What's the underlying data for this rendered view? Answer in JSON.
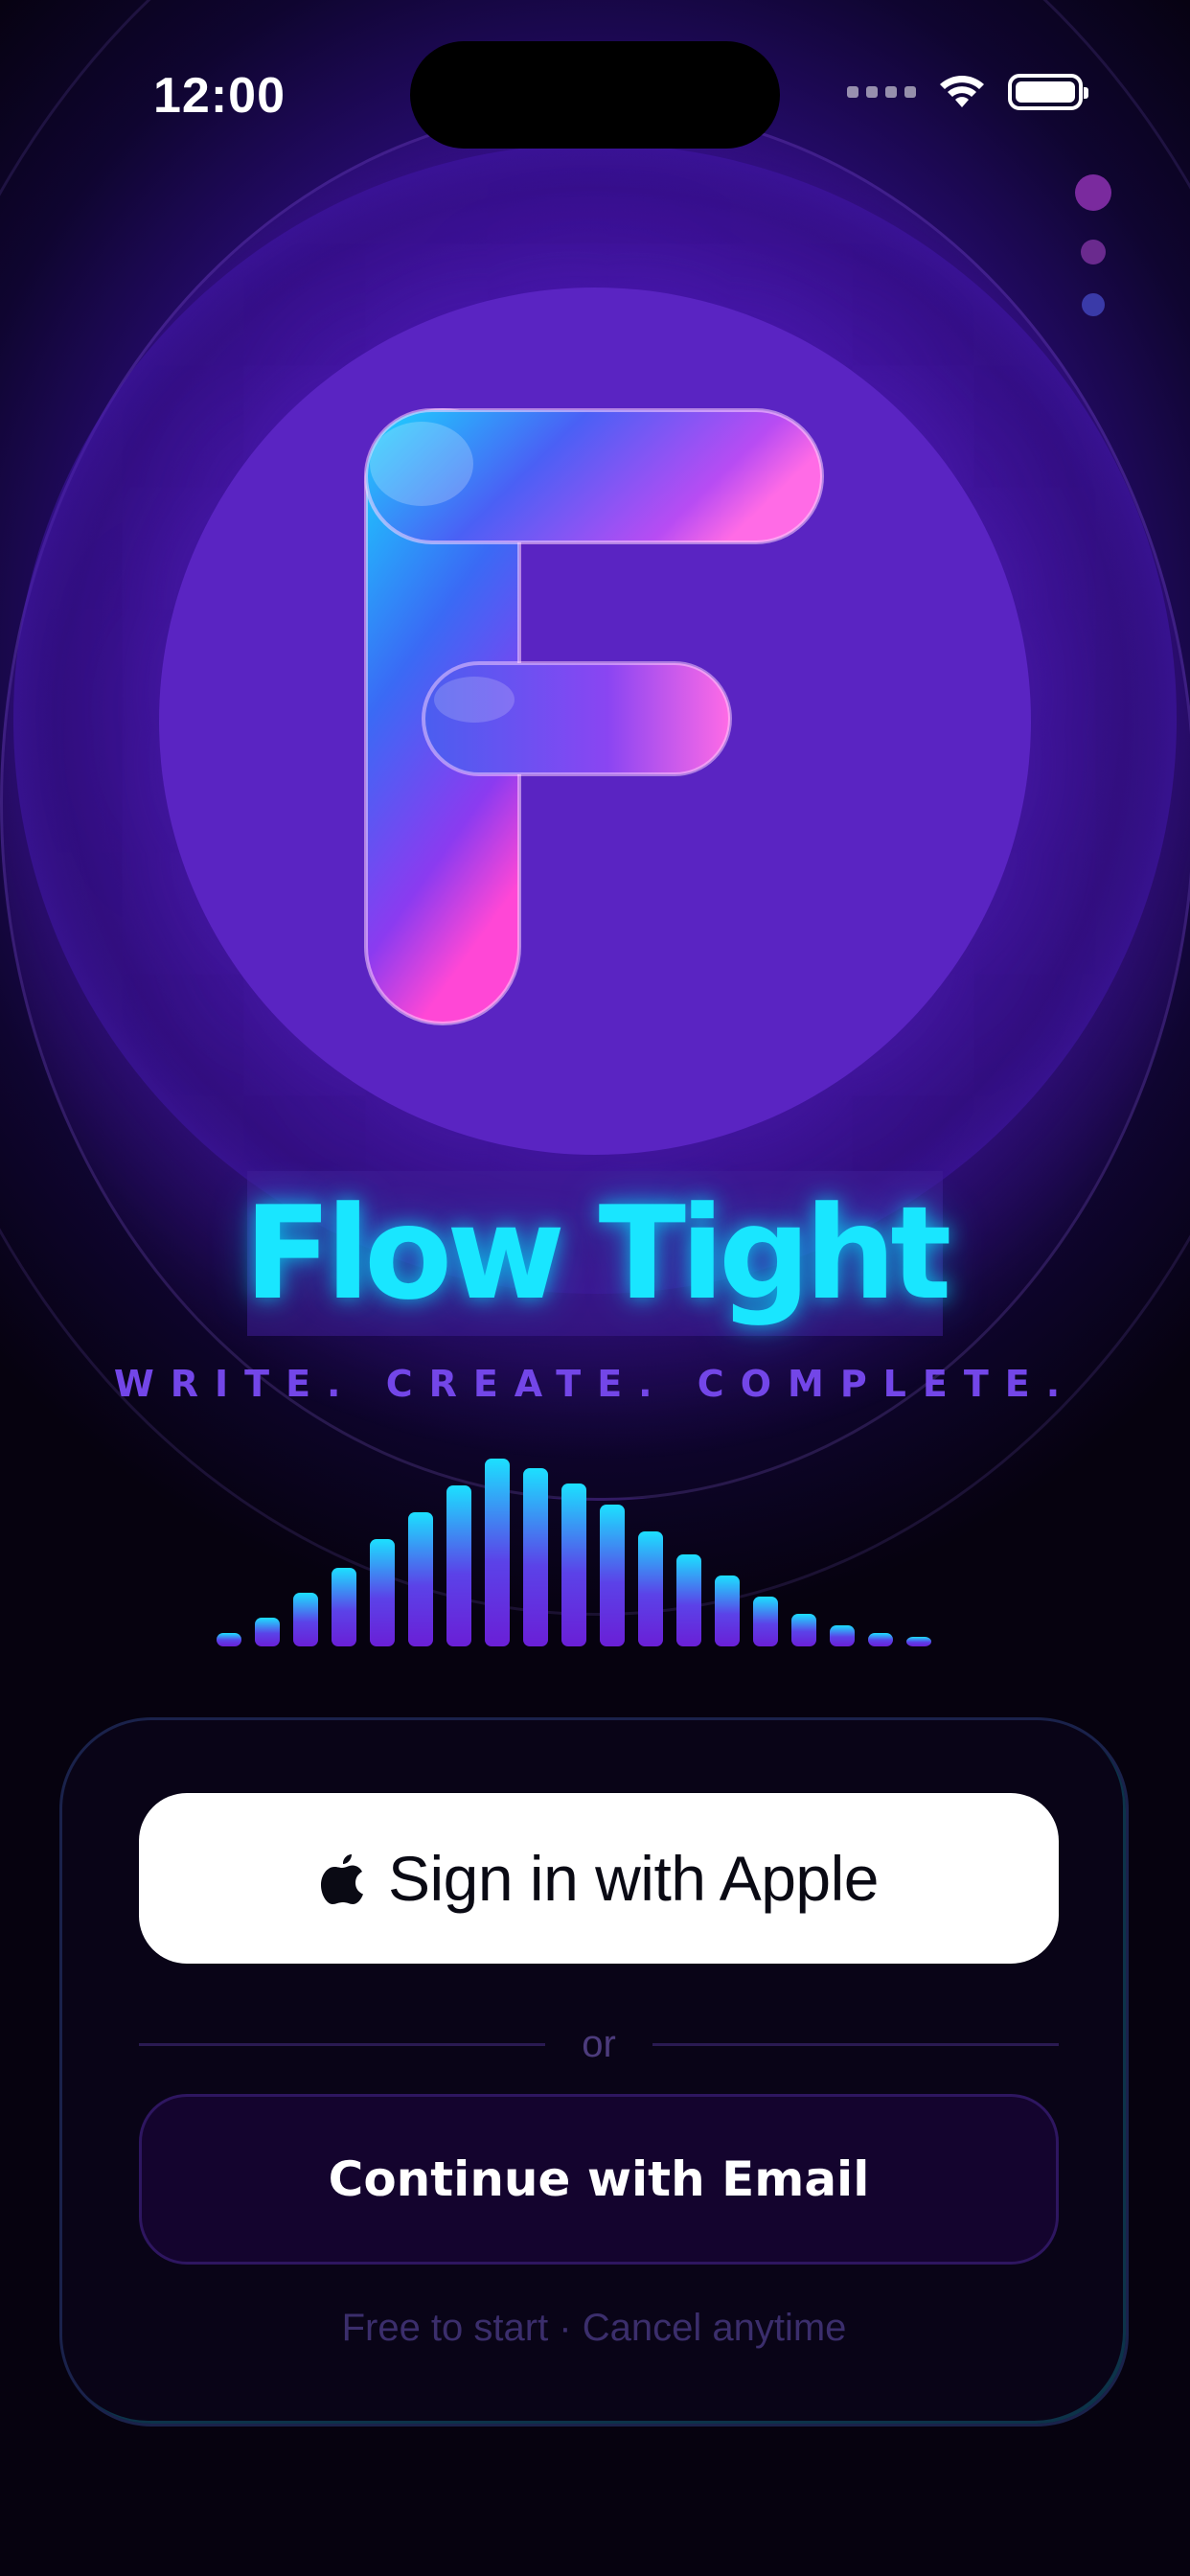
{
  "status_bar": {
    "time": "12:00",
    "wifi_icon": "wifi-icon",
    "battery_icon": "battery-icon"
  },
  "page_indicator": {
    "count": 3,
    "active_index": 0,
    "colors": [
      "#7a2a9e",
      "#6a2a8e",
      "#3a3aa8"
    ]
  },
  "hero": {
    "logo_icon": "app-logo-f-icon",
    "title": "Flow Tight",
    "tagline": "WRITE. CREATE. COMPLETE.",
    "waveform_icon": "audio-waveform-icon"
  },
  "auth": {
    "apple_icon": "apple-logo-icon",
    "apple_label": "Sign in with Apple",
    "divider_text": "or",
    "email_label": "Continue with Email",
    "footnote": "Free to start · Cancel anytime"
  },
  "colors": {
    "accent_cyan": "#19e6ff",
    "accent_purple": "#7346e8",
    "card_bg": "#0a0418",
    "email_button_bg": "#14042e"
  }
}
